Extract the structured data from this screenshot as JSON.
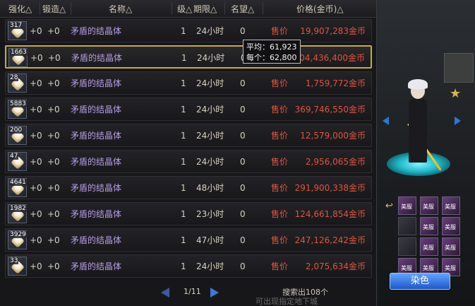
{
  "header": {
    "cols": [
      "强化△",
      "锻造△",
      "名称△",
      "级△",
      "期限△",
      "名望△",
      "价格(金币)△"
    ]
  },
  "rows": [
    {
      "qty": "317",
      "up1": "+0",
      "up2": "+0",
      "name": "矛盾的结晶体",
      "level": "1",
      "duration": "24小时",
      "renown": "0",
      "tag": "售价",
      "price": "19,907,283金币"
    },
    {
      "qty": "1663",
      "up1": "+0",
      "up2": "+0",
      "name": "矛盾的结晶体",
      "level": "1",
      "duration": "24小时",
      "renown": "0",
      "tag": "售价",
      "price": "104,436,400金币"
    },
    {
      "qty": "28",
      "up1": "+0",
      "up2": "+0",
      "name": "矛盾的结晶体",
      "level": "1",
      "duration": "24小时",
      "renown": "0",
      "tag": "售价",
      "price": "1,759,772金币"
    },
    {
      "qty": "5883",
      "up1": "+0",
      "up2": "+0",
      "name": "矛盾的结晶体",
      "level": "1",
      "duration": "24小时",
      "renown": "0",
      "tag": "售价",
      "price": "369,746,550金币"
    },
    {
      "qty": "200",
      "up1": "+0",
      "up2": "+0",
      "name": "矛盾的结晶体",
      "level": "1",
      "duration": "24小时",
      "renown": "0",
      "tag": "售价",
      "price": "12,579,000金币"
    },
    {
      "qty": "47",
      "up1": "+0",
      "up2": "+0",
      "name": "矛盾的结晶体",
      "level": "1",
      "duration": "24小时",
      "renown": "0",
      "tag": "售价",
      "price": "2,956,065金币"
    },
    {
      "qty": "4641",
      "up1": "+0",
      "up2": "+0",
      "name": "矛盾的结晶体",
      "level": "1",
      "duration": "48小时",
      "renown": "0",
      "tag": "售价",
      "price": "291,900,338金币"
    },
    {
      "qty": "1982",
      "up1": "+0",
      "up2": "+0",
      "name": "矛盾的结晶体",
      "level": "1",
      "duration": "23小时",
      "renown": "0",
      "tag": "售价",
      "price": "124,661,854金币"
    },
    {
      "qty": "3929",
      "up1": "+0",
      "up2": "+0",
      "name": "矛盾的结晶体",
      "level": "1",
      "duration": "47小时",
      "renown": "0",
      "tag": "售价",
      "price": "247,126,242金币"
    },
    {
      "qty": "33",
      "up1": "+0",
      "up2": "+0",
      "name": "矛盾的结晶体",
      "level": "1",
      "duration": "24小时",
      "renown": "0",
      "tag": "售价",
      "price": "2,075,634金币"
    }
  ],
  "tooltip": {
    "avg": "平均：61,923",
    "each": "每个：62,800"
  },
  "pager": {
    "text": "1/11"
  },
  "result_count": "搜索出108个",
  "bottom_note": "可出现指定地下城",
  "dye_button": "染色",
  "slot_text": "美服",
  "colors": {
    "accent_gold": "#c7a84a",
    "price_red": "#e0533e",
    "name_purple": "#b79de6",
    "button_blue": "#2156c6"
  },
  "icons": [
    "crystal-icon",
    "prev-page-icon",
    "next-page-icon",
    "swap-icon",
    "star-icon"
  ]
}
